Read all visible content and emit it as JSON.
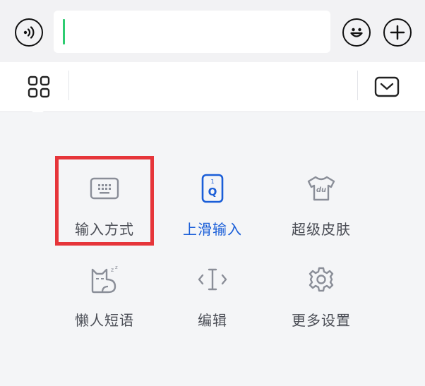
{
  "chat_bar": {
    "voice_icon": "voice-wave-icon",
    "input_value": "",
    "emoji_icon": "smiley-icon",
    "plus_icon": "plus-icon"
  },
  "keyboard_toolbar": {
    "grid_icon": "grid-menu-icon",
    "collapse_icon": "chevron-down-box-icon"
  },
  "menu": {
    "items": [
      {
        "id": "input-mode",
        "label": "输入方式",
        "icon": "keyboard-icon",
        "active": false,
        "highlighted": true
      },
      {
        "id": "swipe-input",
        "label": "上滑输入",
        "icon": "swipe-q-key-icon",
        "active": true,
        "highlighted": false
      },
      {
        "id": "super-skin",
        "label": "超级皮肤",
        "icon": "tshirt-du-icon",
        "active": false,
        "highlighted": false
      },
      {
        "id": "lazy-phrases",
        "label": "懒人短语",
        "icon": "sleeping-cat-icon",
        "active": false,
        "highlighted": false
      },
      {
        "id": "edit",
        "label": "编辑",
        "icon": "text-cursor-icon",
        "active": false,
        "highlighted": false
      },
      {
        "id": "more-settings",
        "label": "更多设置",
        "icon": "gear-icon",
        "active": false,
        "highlighted": false
      }
    ]
  },
  "colors": {
    "accent_blue": "#1a5ed8",
    "highlight_red": "#e6353a",
    "cursor_green": "#2ecc71",
    "icon_gray": "#8a8e98"
  }
}
